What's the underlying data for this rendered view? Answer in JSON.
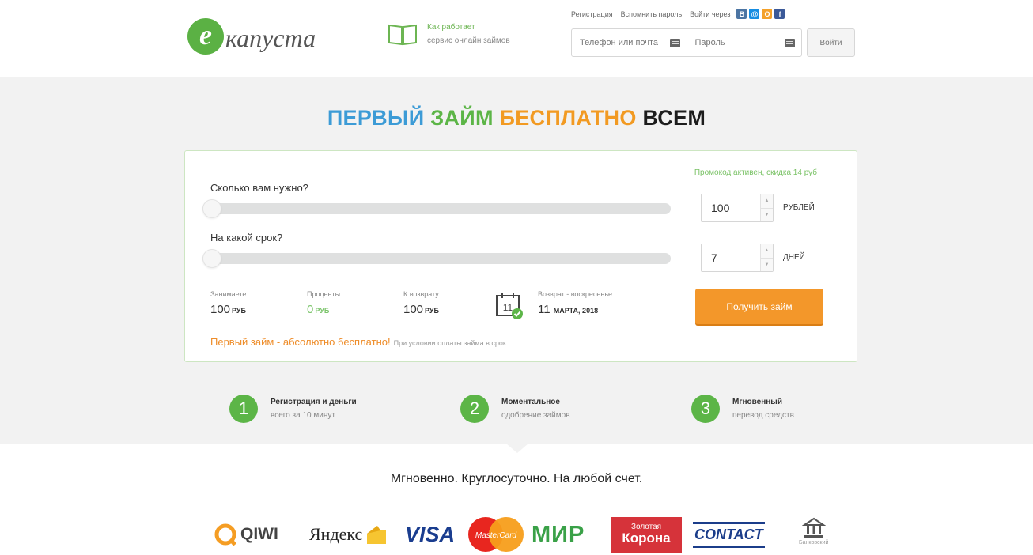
{
  "header": {
    "logo_letter": "e",
    "logo_text": "капуста",
    "how_line1": "Как работает",
    "how_line2": "сервис онлайн займов",
    "links": [
      "Регистрация",
      "Вспомнить пароль",
      "Войти через"
    ],
    "social": [
      {
        "name": "vk",
        "letter": "В",
        "color": "#4c75a3"
      },
      {
        "name": "mail",
        "letter": "@",
        "color": "#168de2"
      },
      {
        "name": "ok",
        "letter": "О",
        "color": "#f4a12a"
      },
      {
        "name": "facebook",
        "letter": "f",
        "color": "#3b5998"
      }
    ],
    "login_placeholder": "Телефон или почта",
    "password_placeholder": "Пароль",
    "login_button": "Войти"
  },
  "headline": [
    "ПЕРВЫЙ",
    "ЗАЙМ",
    "БЕСПЛАТНО",
    "ВСЕМ"
  ],
  "calculator": {
    "promo": "Промокод активен, скидка 14 руб",
    "amount_question": "Сколько вам нужно?",
    "amount_value": "100",
    "amount_unit": "РУБЛЕЙ",
    "amount_slider_fraction": 0,
    "term_question": "На какой срок?",
    "term_value": "7",
    "term_unit": "ДНЕЙ",
    "term_slider_fraction": 0,
    "stats": [
      {
        "label": "Занимаете",
        "value": "100",
        "unit": "РУБ"
      },
      {
        "label": "Проценты",
        "value": "0",
        "unit": "РУБ"
      },
      {
        "label": "К возврату",
        "value": "100",
        "unit": "РУБ"
      }
    ],
    "calendar_day": "11",
    "return_label": "Возврат - воскресенье",
    "return_date": "11",
    "return_month": "МАРТА, 2018",
    "get_button": "Получить займ",
    "free_text": "Первый займ - абсолютно бесплатно!",
    "free_note": "При условии оплаты займа в срок."
  },
  "steps": [
    {
      "num": "1",
      "title": "Регистрация и деньги",
      "sub": "всего за 10 минут"
    },
    {
      "num": "2",
      "title": "Моментальное",
      "sub": "одобрение займов"
    },
    {
      "num": "3",
      "title": "Мгновенный",
      "sub": "перевод средств"
    }
  ],
  "tagline": "Мгновенно. Круглосуточно. На любой счет.",
  "payments": {
    "qiwi": "QIWI",
    "yandex": "Яндекс",
    "visa": "VISA",
    "mastercard": "MasterCard",
    "mir": "МИР",
    "korona_1": "Золотая",
    "korona_2": "Корона",
    "contact": "CONTACT",
    "bank": "Банковский"
  },
  "colors": {
    "green": "#5cb547",
    "orange": "#f3972a",
    "blue": "#3c9bd6",
    "band": "#f2f2f2"
  }
}
